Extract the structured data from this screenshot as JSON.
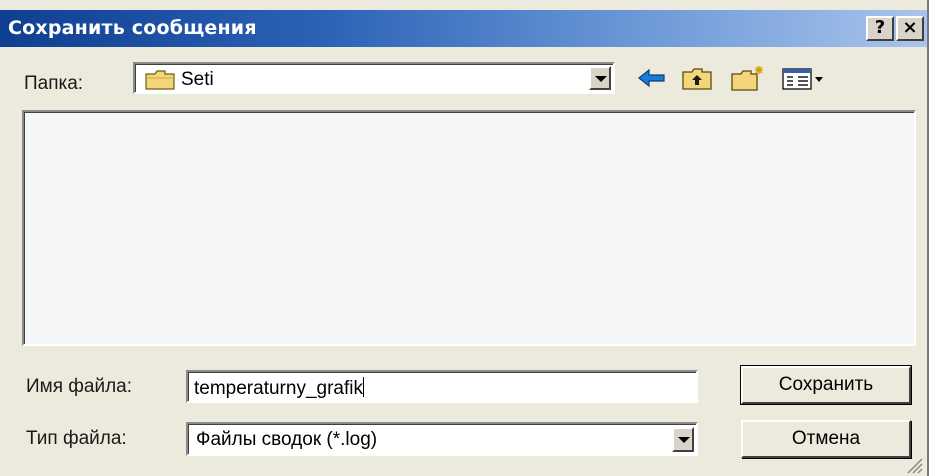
{
  "window": {
    "title": "Сохранить сообщения",
    "help_button": "?",
    "close_button": "×"
  },
  "folder": {
    "label": "Папка:",
    "current": "Seti"
  },
  "toolbar": {
    "icons": [
      "back-arrow-icon",
      "up-one-level-icon",
      "new-folder-icon",
      "view-menu-icon"
    ]
  },
  "filename": {
    "label": "Имя файла:",
    "value": "temperaturny_grafik"
  },
  "filetype": {
    "label": "Тип файла:",
    "value": "Файлы сводок (*.log)"
  },
  "buttons": {
    "save": "Сохранить",
    "cancel": "Отмена"
  },
  "colors": {
    "title_start": "#0f3f91",
    "title_end": "#a9c4ec",
    "dialog_bg": "#ece9dd"
  }
}
